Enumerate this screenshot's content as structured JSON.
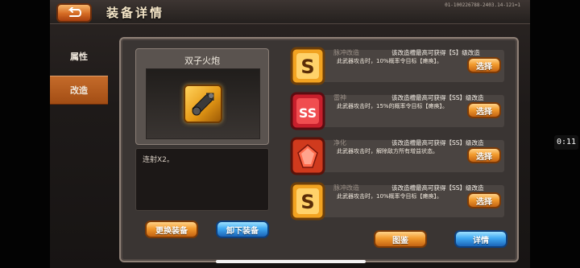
{
  "header": {
    "title": "装备详情",
    "version": "01-100226788-2403.14-121=1"
  },
  "tabs": [
    {
      "label": "属性"
    },
    {
      "label": "改造"
    }
  ],
  "equipment": {
    "name": "双子火炮",
    "description": "连射X2。"
  },
  "left_buttons": {
    "change": "更换装备",
    "unequip": "卸下装备"
  },
  "slots": [
    {
      "title": "脉冲改造",
      "hint": "该改造槽最高可获得【S】级改造",
      "desc": "此武器攻击时，10%概率令目标【瘫痪】。",
      "button": "选择",
      "icon": "S-grade-icon"
    },
    {
      "title": "雷神",
      "hint": "该改造槽最高可获得【SS】级改造",
      "desc": "此武器攻击时，15%的概率令目标【瘫痪】。",
      "button": "选择",
      "icon": "SS-grade-icon"
    },
    {
      "title": "净化",
      "hint": "该改造槽最高可获得【SS】级改造",
      "desc": "此武器攻击时，解除敌方所有增益状态。",
      "button": "选择",
      "icon": "red-gem-icon"
    },
    {
      "title": "脉冲改造",
      "hint": "该改造槽最高可获得【SS】级改造",
      "desc": "此武器攻击时，10%概率令目标【瘫痪】。",
      "button": "选择",
      "icon": "S-grade-icon"
    }
  ],
  "bottom_buttons": {
    "gallery": "图鉴",
    "details": "详情"
  },
  "overlay": {
    "timer": "0:11"
  }
}
